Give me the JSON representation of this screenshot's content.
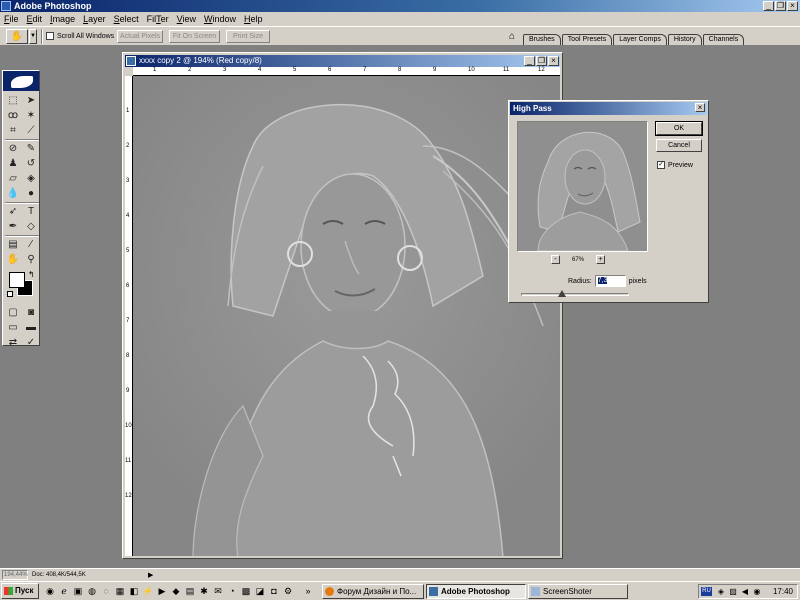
{
  "app": {
    "title": "Adobe Photoshop",
    "window_controls": {
      "minimize": "_",
      "restore": "❐",
      "close": "×"
    }
  },
  "menu": [
    {
      "label": "File",
      "u": "F",
      "rest": "ile"
    },
    {
      "label": "Edit",
      "u": "E",
      "rest": "dit"
    },
    {
      "label": "Image",
      "u": "I",
      "rest": "mage"
    },
    {
      "label": "Layer",
      "u": "L",
      "rest": "ayer"
    },
    {
      "label": "Select",
      "u": "S",
      "rest": "elect"
    },
    {
      "label": "Filter",
      "u": "T",
      "pre": "Fil",
      "rest": "er"
    },
    {
      "label": "View",
      "u": "V",
      "rest": "iew"
    },
    {
      "label": "Window",
      "u": "W",
      "rest": "indow"
    },
    {
      "label": "Help",
      "u": "H",
      "rest": "elp"
    }
  ],
  "options": {
    "scroll_all_label": "Scroll All Windows",
    "scroll_all_checked": false,
    "actual_pixels": "Actual Pixels",
    "fit_on_screen": "Fit On Screen",
    "print_size": "Print Size"
  },
  "palette_well": {
    "tabs": [
      "Brushes",
      "Tool Presets",
      "Layer Comps",
      "History",
      "Channels"
    ]
  },
  "document": {
    "title": "xxxx copy 2 @ 194% (Red copy/8)",
    "ruler_top": [
      "1",
      "2",
      "3",
      "4",
      "5",
      "6",
      "7",
      "8",
      "9",
      "10",
      "11",
      "12"
    ],
    "ruler_left": [
      "1",
      "2",
      "3",
      "4",
      "5",
      "6",
      "7",
      "8",
      "9",
      "10",
      "11",
      "12"
    ]
  },
  "high_pass": {
    "title": "High Pass",
    "ok": "OK",
    "cancel": "Cancel",
    "preview_label": "Preview",
    "preview_checked": true,
    "zoom": "67%",
    "zoom_out": "-",
    "zoom_in": "+",
    "radius_label": "Radius:",
    "radius_value": "7,3",
    "radius_unit": "pixels",
    "slider_fraction": 0.38
  },
  "status": {
    "zoom": "194,44%",
    "doc_size": "Doc: 408,4K/544,5K",
    "arrow": "▶"
  },
  "taskbar": {
    "start": "Пуск",
    "tasks": [
      {
        "label": "Форум Дизайн и По...",
        "active": false
      },
      {
        "label": "Adobe Photoshop",
        "active": true
      },
      {
        "label": "ScreenShoter",
        "active": false
      }
    ],
    "lang": "RU",
    "clock": "17:40"
  }
}
